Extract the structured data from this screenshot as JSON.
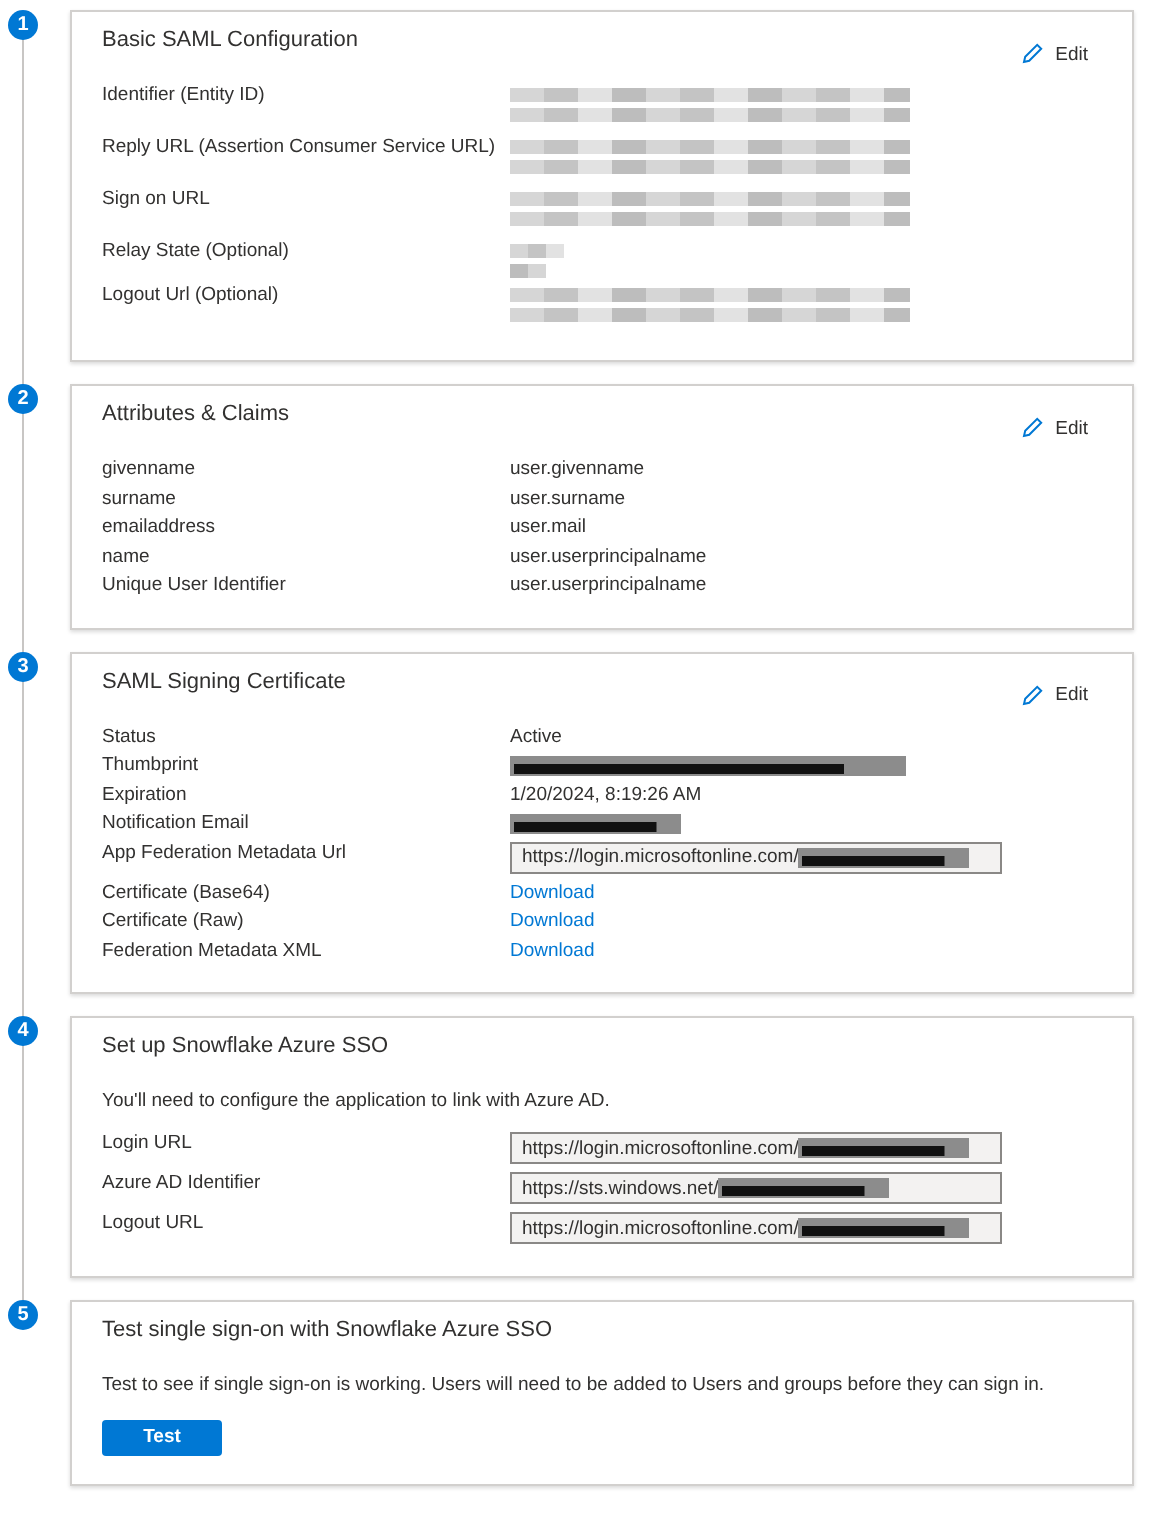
{
  "steps": [
    {
      "number": "1",
      "title": "Basic SAML Configuration",
      "edit": "Edit",
      "rows": [
        {
          "label": "Identifier (Entity ID)",
          "kind": "blur"
        },
        {
          "label": "Reply URL (Assertion Consumer Service URL)",
          "kind": "blur"
        },
        {
          "label": "Sign on URL",
          "kind": "blur"
        },
        {
          "label": "Relay State (Optional)",
          "kind": "blurshort"
        },
        {
          "label": "Logout Url (Optional)",
          "kind": "blur"
        }
      ]
    },
    {
      "number": "2",
      "title": "Attributes & Claims",
      "edit": "Edit",
      "rows": [
        {
          "label": "givenname",
          "kind": "text",
          "value": "user.givenname"
        },
        {
          "label": "surname",
          "kind": "text",
          "value": "user.surname"
        },
        {
          "label": "emailaddress",
          "kind": "text",
          "value": "user.mail"
        },
        {
          "label": "name",
          "kind": "text",
          "value": "user.userprincipalname"
        },
        {
          "label": "Unique User Identifier",
          "kind": "text",
          "value": "user.userprincipalname"
        }
      ]
    },
    {
      "number": "3",
      "title": "SAML Signing Certificate",
      "edit": "Edit",
      "rows": [
        {
          "label": "Status",
          "kind": "text",
          "value": "Active"
        },
        {
          "label": "Thumbprint",
          "kind": "censored"
        },
        {
          "label": "Expiration",
          "kind": "text",
          "value": "1/20/2024, 8:19:26 AM"
        },
        {
          "label": "Notification Email",
          "kind": "censoredshort"
        },
        {
          "label": "App Federation Metadata Url",
          "kind": "field",
          "value": "https://login.microsoftonline.com/"
        },
        {
          "label": "Certificate (Base64)",
          "kind": "link",
          "value": "Download"
        },
        {
          "label": "Certificate (Raw)",
          "kind": "link",
          "value": "Download"
        },
        {
          "label": "Federation Metadata XML",
          "kind": "link",
          "value": "Download"
        }
      ]
    },
    {
      "number": "4",
      "title": "Set up Snowflake Azure SSO",
      "intro": "You'll need to configure the application to link with Azure AD.",
      "rows": [
        {
          "label": "Login URL",
          "kind": "field",
          "value": "https://login.microsoftonline.com/"
        },
        {
          "label": "Azure AD Identifier",
          "kind": "field",
          "value": "https://sts.windows.net/"
        },
        {
          "label": "Logout URL",
          "kind": "field",
          "value": "https://login.microsoftonline.com/"
        }
      ]
    },
    {
      "number": "5",
      "title": "Test single sign-on with Snowflake Azure SSO",
      "intro": "Test to see if single sign-on is working. Users will need to be added to Users and groups before they can sign in.",
      "button": "Test"
    }
  ]
}
